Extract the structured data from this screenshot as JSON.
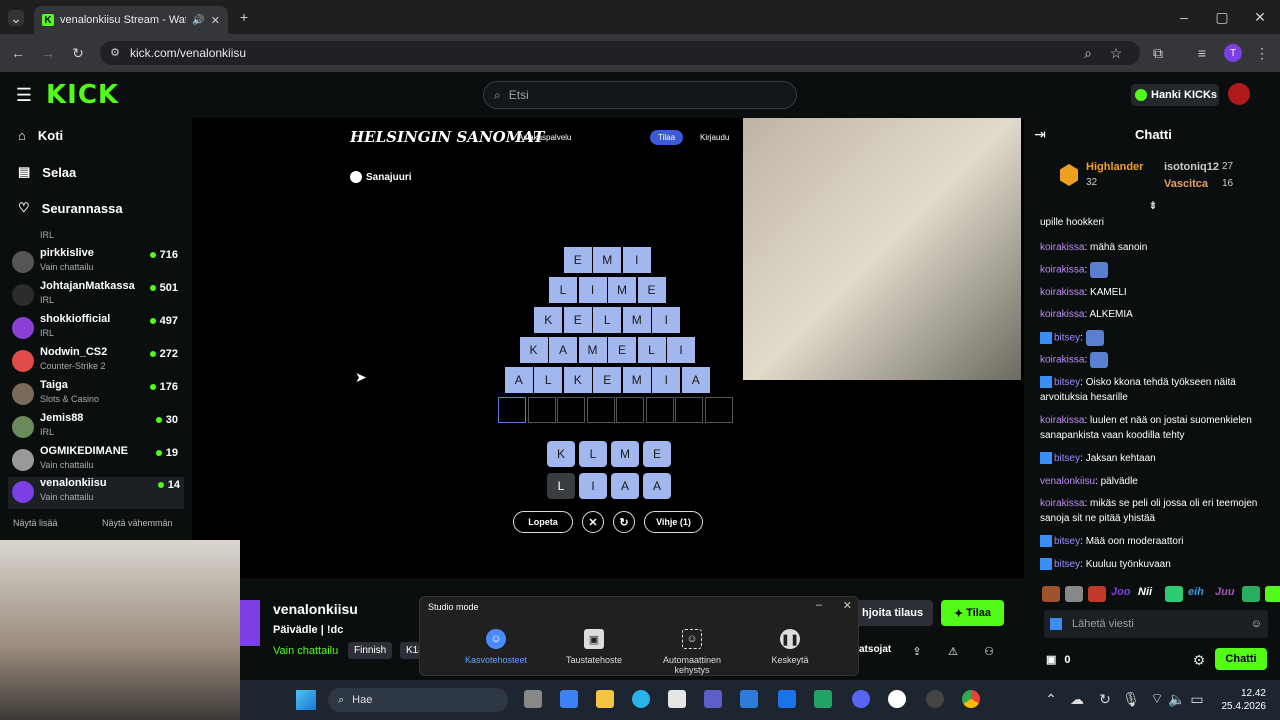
{
  "browser": {
    "tab_title": "venalonkiisu Stream - Watc",
    "url": "kick.com/venalonkiisu",
    "profile_initial": "T"
  },
  "header": {
    "logo": "KICK",
    "search_placeholder": "Etsi",
    "kicks_label": "Hanki KICKs"
  },
  "sidebar": {
    "nav": [
      {
        "label": "Koti"
      },
      {
        "label": "Selaa"
      },
      {
        "label": "Seurannassa"
      }
    ],
    "partial_category": "IRL",
    "channels": [
      {
        "name": "pirkkislive",
        "category": "Vain chattailu",
        "viewers": "716"
      },
      {
        "name": "JohtajanMatkassa",
        "category": "IRL",
        "viewers": "501"
      },
      {
        "name": "shokkiofficial",
        "category": "IRL",
        "viewers": "497"
      },
      {
        "name": "Nodwin_CS2",
        "category": "Counter-Strike 2",
        "viewers": "272"
      },
      {
        "name": "Taiga",
        "category": "Slots & Casino",
        "viewers": "176"
      },
      {
        "name": "Jemis88",
        "category": "IRL",
        "viewers": "30"
      },
      {
        "name": "OGMIKEDIMANE",
        "category": "Vain chattailu",
        "viewers": "19"
      },
      {
        "name": "venalonkiisu",
        "category": "Vain chattailu",
        "viewers": "14"
      }
    ],
    "show_more": "Näytä lisää",
    "show_less": "Näytä vähemmän"
  },
  "game": {
    "brand": "HELSINGIN SANOMAT",
    "customer_service": "Asiakaspalvelu",
    "subscribe": "Tilaa",
    "login": "Kirjaudu",
    "game_name": "Sanajuuri",
    "rows": [
      [
        "E",
        "M",
        "I"
      ],
      [
        "L",
        "I",
        "M",
        "E"
      ],
      [
        "K",
        "E",
        "L",
        "M",
        "I"
      ],
      [
        "K",
        "A",
        "M",
        "E",
        "L",
        "I"
      ],
      [
        "A",
        "L",
        "K",
        "E",
        "M",
        "I",
        "A"
      ]
    ],
    "letters_row1": [
      "K",
      "L",
      "M",
      "E"
    ],
    "letters_row2": [
      "L",
      "I",
      "A",
      "A"
    ],
    "quit_button": "Lopeta",
    "hint_button": "Vihje (1)"
  },
  "stream": {
    "streamer": "venalonkiisu",
    "title": "Päivädle | !dc",
    "category": "Vain chattailu",
    "tags": [
      "Finnish",
      "K18"
    ],
    "subscribe_partial": "hjoita tilaus",
    "follow": "Tilaa",
    "clips_partial": "atsojat"
  },
  "studio": {
    "title": "Studio mode",
    "items": [
      {
        "label": "Kasvotehosteet"
      },
      {
        "label": "Taustatehoste"
      },
      {
        "label": "Automaattinen kehystys"
      },
      {
        "label": "Keskeytä"
      }
    ]
  },
  "chat": {
    "title": "Chatti",
    "leaders": [
      {
        "name": "Highlander",
        "count": "32"
      },
      {
        "name": "isotoniq12",
        "count": "27"
      },
      {
        "name": "Vascitca",
        "count": "16"
      }
    ],
    "messages": [
      {
        "user": "",
        "text": "upille hookkeri"
      },
      {
        "user": "koirakissa",
        "text": "mähä sanoin"
      },
      {
        "user": "koirakissa",
        "text": ""
      },
      {
        "user": "koirakissa",
        "text": "KAMELI"
      },
      {
        "user": "koirakissa",
        "text": "ALKEMIA"
      },
      {
        "user": "bitsey",
        "text": ""
      },
      {
        "user": "koirakissa",
        "text": ""
      },
      {
        "user": "bitsey",
        "text": "Oisko kkona tehdä työkseen näitä arvoituksia hesarille"
      },
      {
        "user": "koirakissa",
        "text": "luulen et nää on jostai suomenkielen sanapankista vaan koodilla tehty"
      },
      {
        "user": "bitsey",
        "text": "Jaksan kehtaan"
      },
      {
        "user": "venalonkiisu",
        "text": "pälvädle"
      },
      {
        "user": "koirakissa",
        "text": "mikäs se peli oli jossa oli eri teemojen sanoja sit ne pitää yhistää"
      },
      {
        "user": "bitsey",
        "text": "Mää oon moderaattori"
      },
      {
        "user": "bitsey",
        "text": "Kuuluu työnkuvaan"
      }
    ],
    "emote_words": [
      "Joo",
      "Nii",
      "eih",
      "Juu"
    ],
    "input_placeholder": "Lähetä viesti",
    "kicks_count": "0",
    "send_button": "Chatti"
  },
  "taskbar": {
    "search": "Hae",
    "time": "12.42",
    "date": "25.4.2026"
  }
}
